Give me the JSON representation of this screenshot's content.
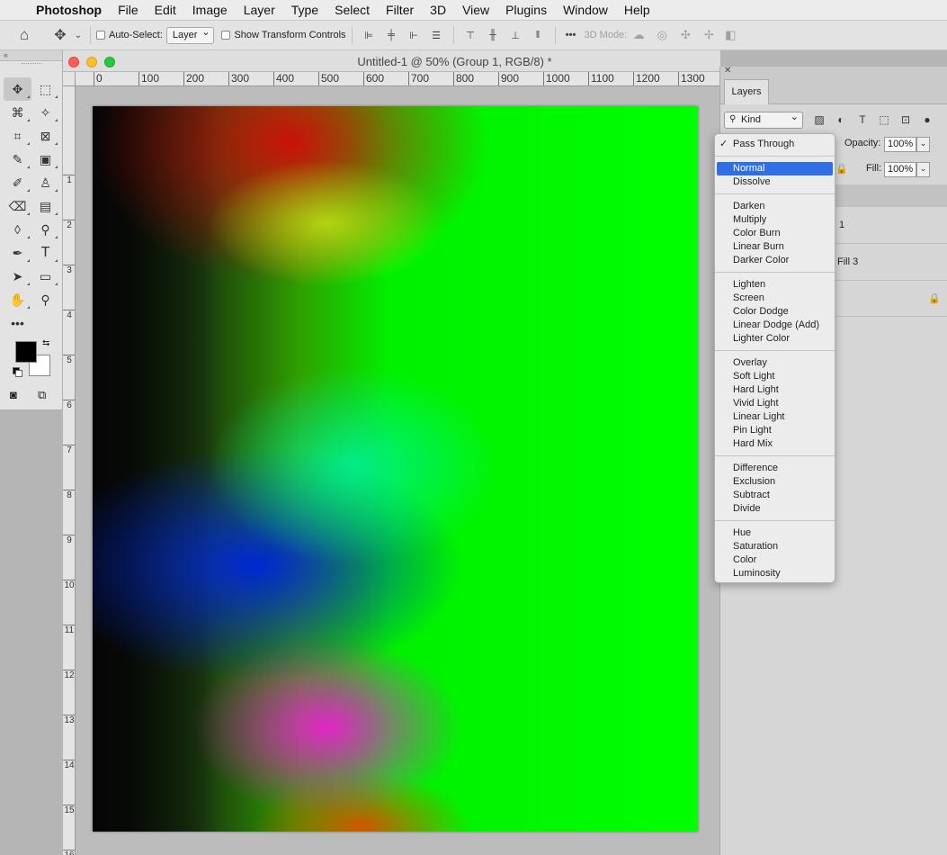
{
  "menubar": {
    "app_name": "Photoshop",
    "items": [
      "File",
      "Edit",
      "Image",
      "Layer",
      "Type",
      "Select",
      "Filter",
      "3D",
      "View",
      "Plugins",
      "Window",
      "Help"
    ]
  },
  "options_bar": {
    "auto_select_label": "Auto-Select:",
    "auto_select_target": "Layer",
    "show_transform_label": "Show Transform Controls",
    "more_label": "•••",
    "mode_3d_label": "3D Mode:"
  },
  "document": {
    "title": "Untitled-1 @ 50% (Group 1, RGB/8) *",
    "ruler_h": [
      "0",
      "100",
      "200",
      "300",
      "400",
      "500",
      "600",
      "700",
      "800",
      "900",
      "1000",
      "1100",
      "1200",
      "1300"
    ],
    "ruler_v": [
      "1",
      "2",
      "3",
      "4",
      "5",
      "6",
      "7",
      "8",
      "9",
      "10",
      "11",
      "12",
      "13",
      "14",
      "15",
      "16"
    ]
  },
  "toolbar": {
    "collapse_label": "«",
    "more_tools_label": "•••"
  },
  "layers_panel": {
    "tab_label": "Layers",
    "kind_label": "Kind",
    "opacity_label": "Opacity:",
    "opacity_value": "100%",
    "fill_label": "Fill:",
    "fill_value": "100%",
    "layer_1_partial": "1",
    "layer_2_partial": "Fill 3"
  },
  "blend_menu": {
    "checked": "Pass Through",
    "selected": "Normal",
    "groups": [
      [
        "Normal",
        "Dissolve"
      ],
      [
        "Darken",
        "Multiply",
        "Color Burn",
        "Linear Burn",
        "Darker Color"
      ],
      [
        "Lighten",
        "Screen",
        "Color Dodge",
        "Linear Dodge (Add)",
        "Lighter Color"
      ],
      [
        "Overlay",
        "Soft Light",
        "Hard Light",
        "Vivid Light",
        "Linear Light",
        "Pin Light",
        "Hard Mix"
      ],
      [
        "Difference",
        "Exclusion",
        "Subtract",
        "Divide"
      ],
      [
        "Hue",
        "Saturation",
        "Color",
        "Luminosity"
      ]
    ]
  },
  "colors": {
    "foreground": "#000000",
    "background": "#ffffff",
    "menu_highlight": "#2f6ee3"
  }
}
